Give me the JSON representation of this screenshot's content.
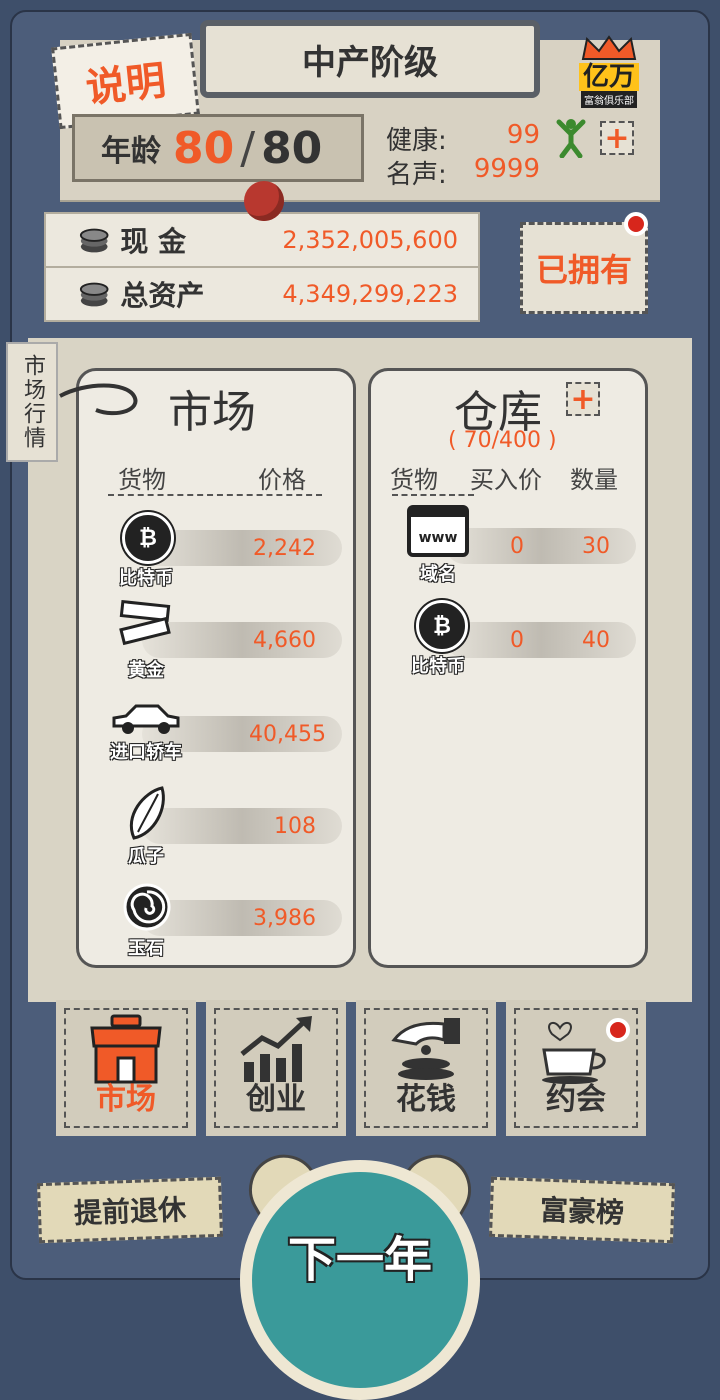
{
  "header": {
    "explain_label": "说明",
    "class_title": "中产阶级",
    "club_badge_big": "亿万",
    "club_badge_small": "富翁俱乐部"
  },
  "age": {
    "label": "年龄",
    "current": "80",
    "separator": "/",
    "max": "80"
  },
  "stats": {
    "health_label": "健康:",
    "health_value": "99",
    "fame_label": "名声:",
    "fame_value": "9999"
  },
  "money": {
    "cash_label": "现  金",
    "cash_value": "2,352,005,600",
    "assets_label": "总资产",
    "assets_value": "4,349,299,223"
  },
  "owned_button": "已拥有",
  "side_tab": "市场行情",
  "market": {
    "title": "市场",
    "col_goods": "货物",
    "col_price": "价格",
    "items": [
      {
        "name": "比特币",
        "price": "2,242",
        "icon": "bitcoin-icon"
      },
      {
        "name": "黄金",
        "price": "4,660",
        "icon": "gold-bar-icon"
      },
      {
        "name": "进口轿车",
        "price": "40,455",
        "icon": "car-icon"
      },
      {
        "name": "瓜子",
        "price": "108",
        "icon": "seed-icon"
      },
      {
        "name": "玉石",
        "price": "3,986",
        "icon": "jade-icon"
      }
    ]
  },
  "warehouse": {
    "title": "仓库",
    "capacity": "( 70/400 )",
    "col_goods": "货物",
    "col_buy": "买入价",
    "col_qty": "数量",
    "items": [
      {
        "name": "域名",
        "buy": "0",
        "qty": "30",
        "icon": "www-icon"
      },
      {
        "name": "比特币",
        "buy": "0",
        "qty": "40",
        "icon": "bitcoin-icon"
      }
    ]
  },
  "tabs": [
    {
      "label": "市场",
      "icon": "shop-icon",
      "active": true
    },
    {
      "label": "创业",
      "icon": "chart-growth-icon",
      "active": false
    },
    {
      "label": "花钱",
      "icon": "hand-coins-icon",
      "active": false
    },
    {
      "label": "约会",
      "icon": "coffee-hearts-icon",
      "active": false
    }
  ],
  "bottom": {
    "retire": "提前退休",
    "rich_list": "富豪榜",
    "next_year": "下一年"
  },
  "colors": {
    "accent": "#f05a28",
    "frame": "#4c5d7a",
    "paper": "#e6e1d4",
    "alert": "#d7261c"
  }
}
